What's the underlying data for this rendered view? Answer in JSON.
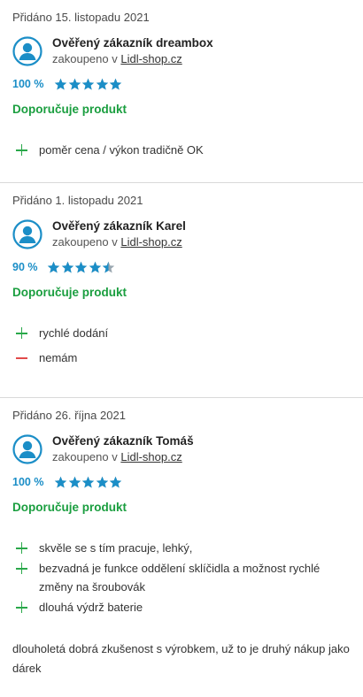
{
  "colors": {
    "accent_blue": "#1b8ec7",
    "recommend_green": "#1a9e3f",
    "plus_green": "#2aa84a",
    "minus_red": "#e14a4a"
  },
  "reviews": [
    {
      "added": "Přidáno 15. listopadu 2021",
      "author": "Ověřený zákazník dreambox",
      "purchased_prefix": "zakoupeno v",
      "shop": "Lidl-shop.cz",
      "rating_pct": "100 %",
      "rating_value": 5,
      "recommend": "Doporučuje produkt",
      "pros": [
        "poměr cena / výkon tradičně OK"
      ],
      "cons": []
    },
    {
      "added": "Přidáno 1. listopadu 2021",
      "author": "Ověřený zákazník Karel",
      "purchased_prefix": "zakoupeno v",
      "shop": "Lidl-shop.cz",
      "rating_pct": "90 %",
      "rating_value": 4.5,
      "recommend": "Doporučuje produkt",
      "pros": [
        "rychlé dodání"
      ],
      "cons": [
        "nemám"
      ]
    },
    {
      "added": "Přidáno 26. října 2021",
      "author": "Ověřený zákazník Tomáš",
      "purchased_prefix": "zakoupeno v",
      "shop": "Lidl-shop.cz",
      "rating_pct": "100 %",
      "rating_value": 5,
      "recommend": "Doporučuje produkt",
      "pros": [
        "skvěle se s tím pracuje, lehký,",
        "bezvadná je funkce oddělení sklíčidla a možnost rychlé změny na šroubovák",
        "dlouhá výdrž baterie"
      ],
      "cons": [],
      "comment": "dlouholetá dobrá zkušenost s výrobkem, už to je druhý nákup jako dárek"
    }
  ]
}
